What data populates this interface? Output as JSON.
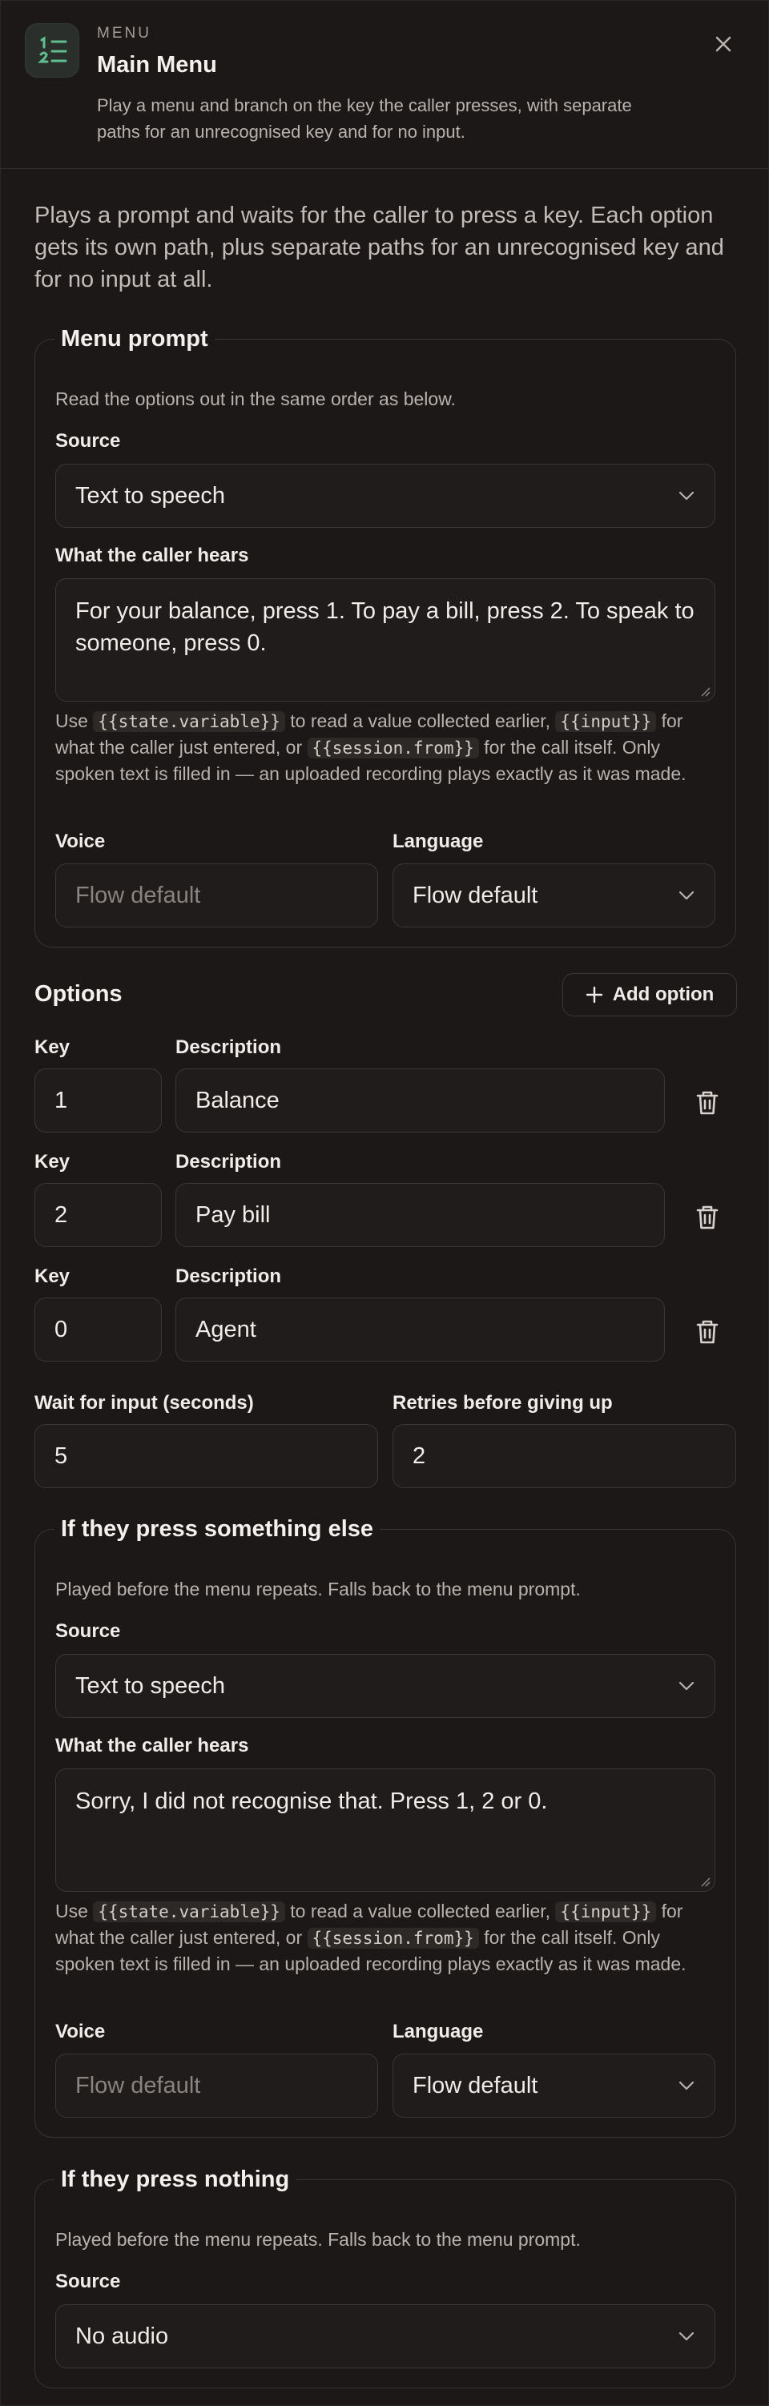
{
  "header": {
    "eyebrow": "MENU",
    "title": "Main Menu",
    "subtitle": "Play a menu and branch on the key the caller presses, with separate paths for an unrecognised key and for no input."
  },
  "intro": "Plays a prompt and waits for the caller to press a key. Each option gets its own path, plus separate paths for an unrecognised key and for no input at all.",
  "help": {
    "use": "Use",
    "state_token": "{{state.variable}}",
    "mid1": "to read a value collected earlier,",
    "input_token": "{{input}}",
    "mid2": "for what the caller just entered, or",
    "session_token": "{{session.from}}",
    "tail": "for the call itself. Only spoken text is filled in — an uploaded recording plays exactly as it was made."
  },
  "menu_prompt": {
    "title": "Menu prompt",
    "note": "Read the options out in the same order as below.",
    "source_label": "Source",
    "source_value": "Text to speech",
    "hears_label": "What the caller hears",
    "hears_value": "For your balance, press 1. To pay a bill, press 2. To speak to someone, press 0.",
    "voice_label": "Voice",
    "voice_placeholder": "Flow default",
    "language_label": "Language",
    "language_value": "Flow default"
  },
  "options": {
    "title": "Options",
    "add_label": "Add option",
    "key_label": "Key",
    "description_label": "Description",
    "items": [
      {
        "key": "1",
        "description": "Balance"
      },
      {
        "key": "2",
        "description": "Pay bill"
      },
      {
        "key": "0",
        "description": "Agent"
      }
    ]
  },
  "timing": {
    "wait_label": "Wait for input (seconds)",
    "wait_value": "5",
    "retries_label": "Retries before giving up",
    "retries_value": "2"
  },
  "invalid": {
    "title": "If they press something else",
    "note": "Played before the menu repeats. Falls back to the menu prompt.",
    "source_label": "Source",
    "source_value": "Text to speech",
    "hears_label": "What the caller hears",
    "hears_value": "Sorry, I did not recognise that. Press 1, 2 or 0.",
    "voice_label": "Voice",
    "voice_placeholder": "Flow default",
    "language_label": "Language",
    "language_value": "Flow default"
  },
  "noinput": {
    "title": "If they press nothing",
    "note": "Played before the menu repeats. Falls back to the menu prompt.",
    "source_label": "Source",
    "source_value": "No audio"
  },
  "colors": {
    "background": "#1b1817",
    "icon_accent": "#5fbf8f",
    "border": "#3c3735"
  }
}
